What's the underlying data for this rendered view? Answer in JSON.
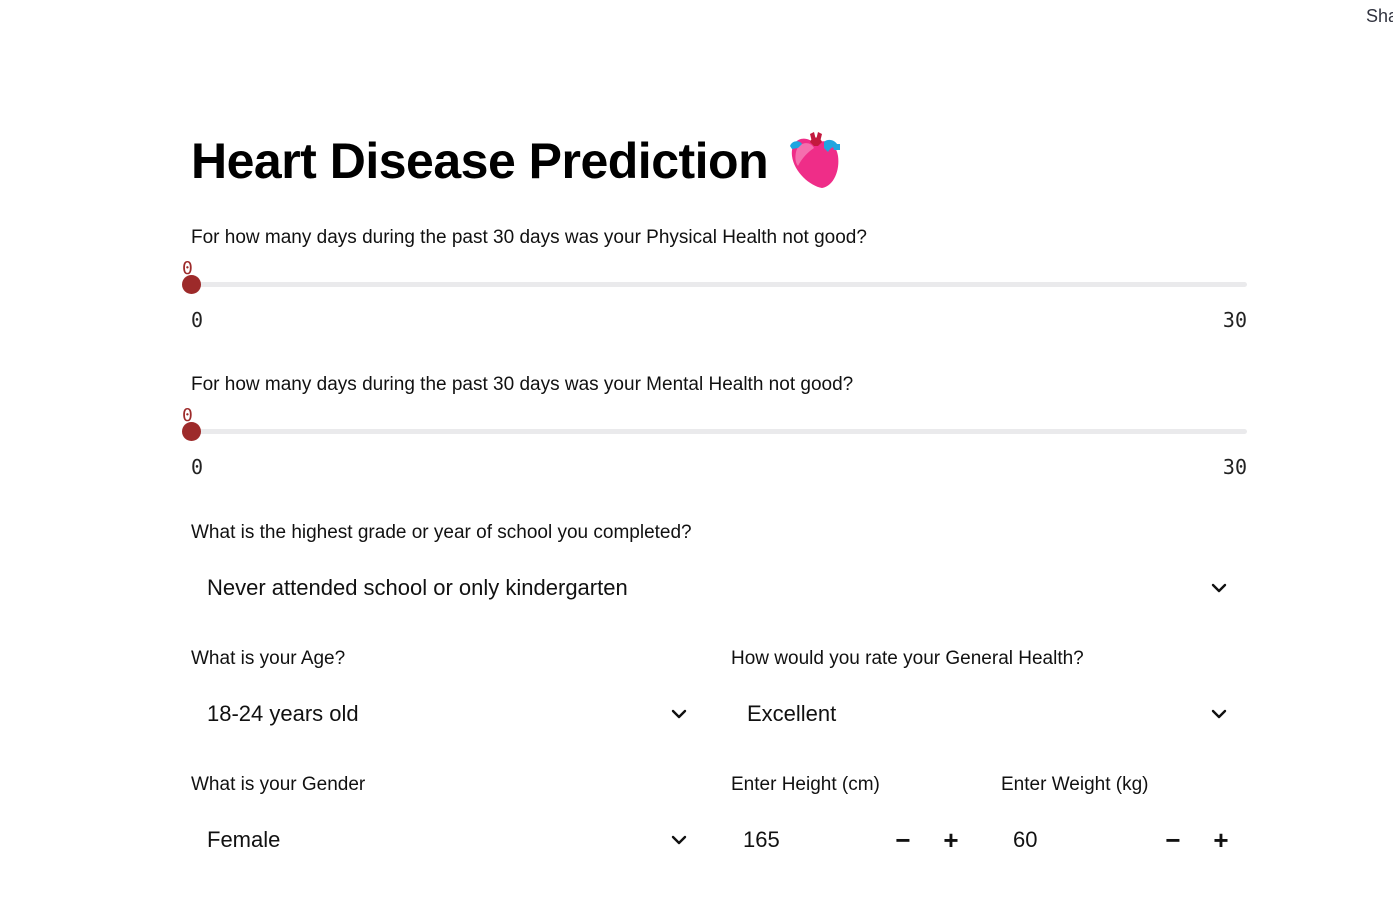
{
  "header": {
    "share_label": "Share"
  },
  "page": {
    "title": "Heart Disease Prediction"
  },
  "physical_health": {
    "label": "For how many days during the past 30 days was your Physical Health not good?",
    "value": "0",
    "min": "0",
    "max": "30"
  },
  "mental_health": {
    "label": "For how many days during the past 30 days was your Mental Health not good?",
    "value": "0",
    "min": "0",
    "max": "30"
  },
  "education": {
    "label": "What is the highest grade or year of school you completed?",
    "selected": "Never attended school or only kindergarten"
  },
  "age": {
    "label": "What is your Age?",
    "selected": "18-24 years old"
  },
  "general_health": {
    "label": "How would you rate your General Health?",
    "selected": "Excellent"
  },
  "gender": {
    "label": "What is your Gender",
    "selected": "Female"
  },
  "height": {
    "label": "Enter Height (cm)",
    "value": "165",
    "minus": "−",
    "plus": "+"
  },
  "weight": {
    "label": "Enter Weight (kg)",
    "value": "60",
    "minus": "−",
    "plus": "+"
  },
  "colors": {
    "accent": "#9d2a2a",
    "track": "#eaeaec",
    "text": "#31333f"
  },
  "icons": {
    "title_icon": "anatomical-heart-icon",
    "dropdown_icon": "chevron-down-icon"
  }
}
